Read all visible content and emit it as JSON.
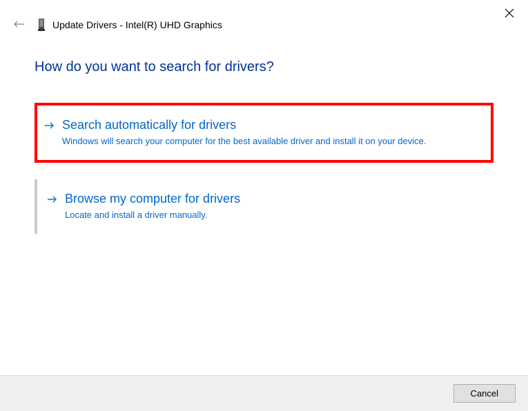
{
  "header": {
    "title": "Update Drivers - Intel(R) UHD Graphics"
  },
  "question": "How do you want to search for drivers?",
  "options": {
    "auto": {
      "title": "Search automatically for drivers",
      "desc": "Windows will search your computer for the best available driver and install it on your device."
    },
    "browse": {
      "title": "Browse my computer for drivers",
      "desc": "Locate and install a driver manually."
    }
  },
  "footer": {
    "cancel": "Cancel"
  }
}
